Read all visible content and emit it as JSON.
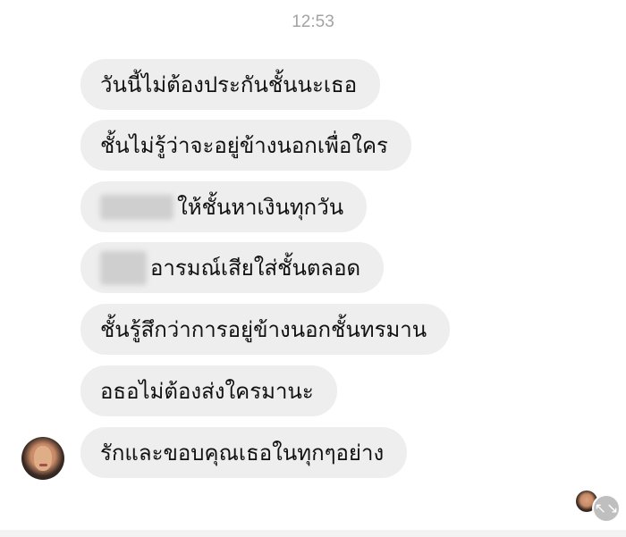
{
  "chat": {
    "timestamp": "12:53",
    "messages": [
      {
        "text": "วันนี้ไม่ต้องประกันชั้นนะเธอ"
      },
      {
        "text": "ชั้นไม่รู้ว่าจะอยู่ข้างนอกเพื่อใคร"
      },
      {
        "text": "ให้ชั้นหาเงินทุกวัน"
      },
      {
        "text": "อารมณ์เสียใส่ชั้นตลอด"
      },
      {
        "text": "ชั้นรู้สึกว่าการอยู่ข้างนอกชั้นทรมาน"
      },
      {
        "text": "อธอไม่ต้องส่งใครมานะ"
      },
      {
        "text": "รักและขอบคุณเธอในทุกๆอย่าง"
      }
    ],
    "expand_icon": "↖↘",
    "icons": {
      "expand": "expand-arrows-icon",
      "avatar": "sender-avatar"
    }
  }
}
